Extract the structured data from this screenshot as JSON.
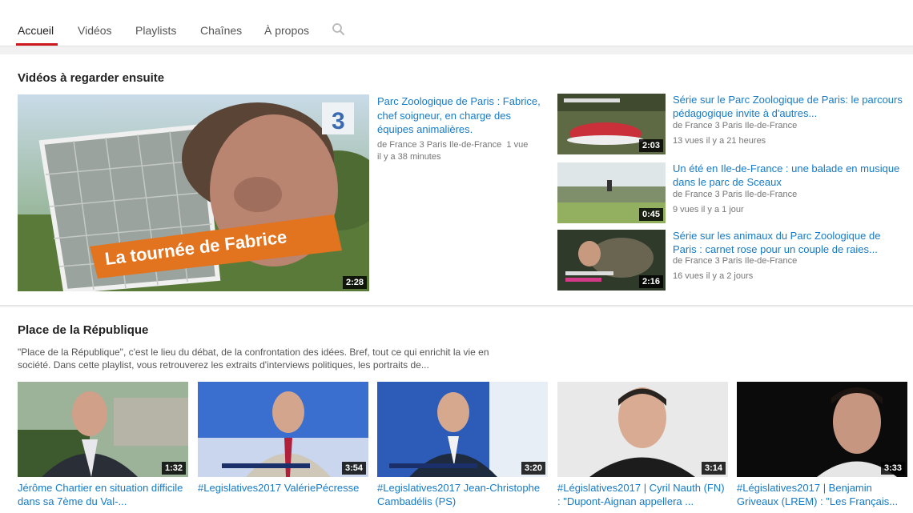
{
  "tabs": [
    {
      "label": "Accueil"
    },
    {
      "label": "Vidéos"
    },
    {
      "label": "Playlists"
    },
    {
      "label": "Chaînes"
    },
    {
      "label": "À propos"
    }
  ],
  "search_icon": "search-icon",
  "featured": {
    "section_title": "Vidéos à regarder ensuite",
    "main": {
      "title": "Parc Zoologique de Paris : Fabrice, chef soigneur, en charge des équipes animalières.",
      "channel": "de France 3 Paris Ile-de-France",
      "views": "1 vue",
      "age": "il y a 38 minutes",
      "duration": "2:28",
      "overlay_text": "La tournée de Fabrice",
      "logo_text": "3"
    },
    "side": [
      {
        "title": "Série sur le Parc Zoologique de Paris: le parcours pédagogique invite à d'autres...",
        "channel": "de France 3 Paris Ile-de-France",
        "meta": "13 vues   il y a 21 heures",
        "duration": "2:03"
      },
      {
        "title": "Un été en Ile-de-France : une balade en musique dans le parc de Sceaux",
        "channel": "de France 3 Paris Ile-de-France",
        "meta": "9 vues   il y a 1 jour",
        "duration": "0:45"
      },
      {
        "title": "Série sur les animaux du Parc Zoologique de Paris : carnet rose pour un couple de raies...",
        "channel": "de France 3 Paris Ile-de-France",
        "meta": "16 vues   il y a 2 jours",
        "duration": "2:16"
      }
    ]
  },
  "playlist": {
    "title": "Place de la République",
    "description": "\"Place de la République\", c'est le lieu du débat, de la confrontation des idées. Bref, tout ce qui enrichit la vie en société. Dans cette playlist, vous retrouverez les extraits d'interviews politiques, les portraits de...",
    "videos": [
      {
        "title": "Jérôme Chartier en situation difficile dans sa 7ème du Val-...",
        "duration": "1:32"
      },
      {
        "title": "#Legislatives2017 ValériePécresse",
        "duration": "3:54"
      },
      {
        "title": "#Legislatives2017 Jean-Christophe Cambadélis (PS)",
        "duration": "3:20"
      },
      {
        "title": "#Législatives2017 | Cyril Nauth (FN) : \"Dupont-Aignan appellera ...",
        "duration": "3:14"
      },
      {
        "title": "#Législatives2017 | Benjamin Griveaux (LREM) : \"Les Français...",
        "duration": "3:33"
      }
    ]
  }
}
